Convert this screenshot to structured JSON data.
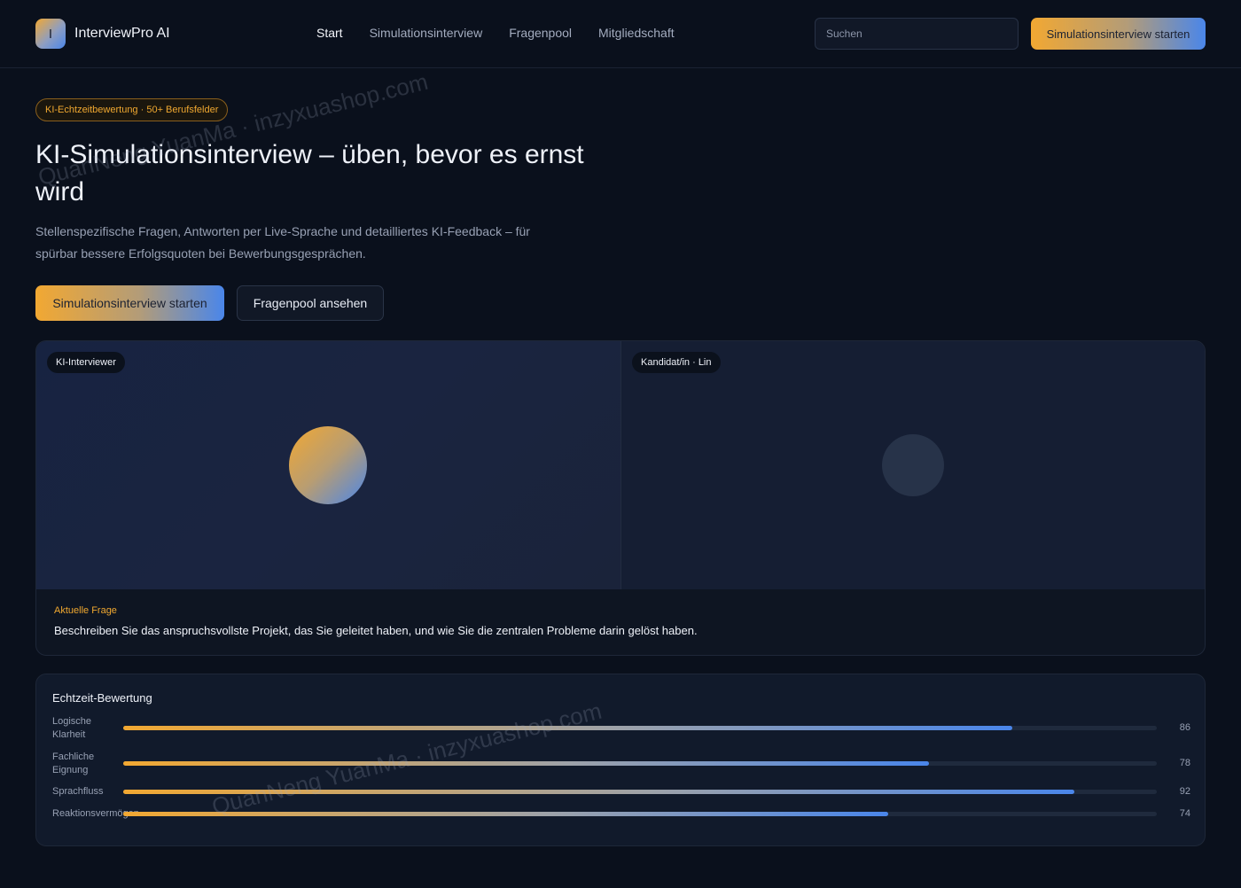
{
  "header": {
    "logo_letter": "I",
    "app_name": "InterviewPro AI",
    "nav": [
      "Start",
      "Simulationsinterview",
      "Fragenpool",
      "Mitgliedschaft"
    ],
    "search_placeholder": "Suchen",
    "cta_label": "Simulationsinterview starten"
  },
  "hero": {
    "badge": "KI-Echtzeitbewertung · 50+ Berufsfelder",
    "title": "KI-Simulationsinterview – üben, bevor es ernst wird",
    "subtitle": "Stellenspezifische Fragen, Antworten per Live-Sprache und detailliertes KI-Feedback – für spürbar bessere Erfolgsquoten bei Bewerbungsgesprächen.",
    "primary_button": "Simulationsinterview starten",
    "secondary_button": "Fragenpool ansehen"
  },
  "interview": {
    "interviewer_tag": "KI-Interviewer",
    "candidate_tag": "Kandidat/in · Lin",
    "question_label": "Aktuelle Frage",
    "question_text": "Beschreiben Sie das anspruchsvollste Projekt, das Sie geleitet haben, und wie Sie die zentralen Probleme darin gelöst haben."
  },
  "scores": {
    "title": "Echtzeit-Bewertung",
    "items": [
      {
        "label": "Logische Klarheit",
        "value": 86
      },
      {
        "label": "Fachliche Eignung",
        "value": 78
      },
      {
        "label": "Sprachfluss",
        "value": 92
      },
      {
        "label": "Reaktionsvermögen",
        "value": 74
      }
    ]
  },
  "watermark": "QuanNeng YuanMa · inzyxuashop.com",
  "colors": {
    "background": "#0a101c",
    "accent_orange": "#f2a832",
    "accent_blue": "#4a86ea"
  }
}
